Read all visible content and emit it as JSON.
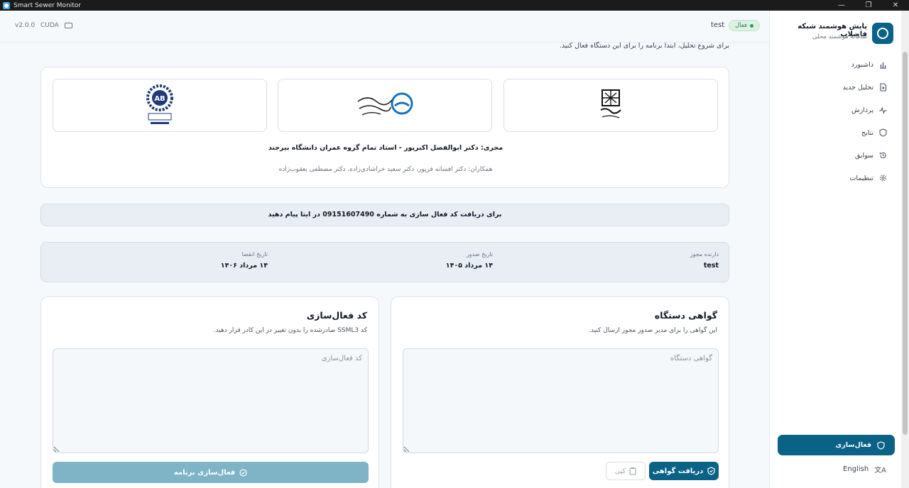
{
  "window": {
    "title": "Smart Sewer Monitor"
  },
  "topbar": {
    "version": "v2.0.0",
    "device": "CUDA",
    "user": "test",
    "status": "فعال"
  },
  "instruction": "برای شروع تحلیل، ابتدا برنامه را برای این دستگاه فعال کنید.",
  "credits": {
    "executor": "مجری: دکتر ابوالفضل اکبرپور - استاد تمام گروه عمران دانشگاه بیرجند",
    "colleagues": "همکاران: دکتر افسانه فرپور، دکتر سعید خراشادی‌زاده، دکتر مصطفی یعقوب‌زاده",
    "logos": [
      "logo-birjand-university",
      "logo-water-wastewater-company",
      "logo-abtiran"
    ]
  },
  "notice": "برای دریافت کد فعال سازی به شماره 09151607490 در ایتا پیام دهید",
  "license": {
    "holder_label": "دارنده مجوز",
    "holder": "test",
    "issue_label": "تاریخ صدور",
    "issue": "۱۴ مرداد ۱۴۰۵",
    "expire_label": "تاریخ انقضا",
    "expire": "۱۴ مرداد ۱۴۰۶"
  },
  "certificate": {
    "title": "گواهی دستگاه",
    "desc": "این گواهی را برای مدیر صدور مجوز ارسال کنید.",
    "placeholder": "گواهی دستگاه",
    "get_label": "دریافت گواهی",
    "copy_label": "کپی"
  },
  "activation": {
    "title": "کد فعال‌سازی",
    "desc": "کد SSML3 صادرشده را بدون تغییر در این کادر قرار دهید.",
    "placeholder": "کد فعال‌سازی",
    "activate_label": "فعال‌سازی برنامه"
  },
  "sidebar": {
    "title": "پایش هوشمند شبکه فاضلاب",
    "subtitle": "سامانه هوشمند محلی",
    "items": [
      {
        "label": "داشبورد",
        "icon": "bar-chart-icon"
      },
      {
        "label": "تحلیل جدید",
        "icon": "file-plus-icon"
      },
      {
        "label": "پردازش",
        "icon": "activity-icon"
      },
      {
        "label": "نتایج",
        "icon": "shield-icon"
      },
      {
        "label": "سوابق",
        "icon": "history-icon"
      },
      {
        "label": "تنظیمات",
        "icon": "gear-icon"
      }
    ],
    "activate": "فعال‌سازی",
    "language": "English"
  },
  "colors": {
    "primary": "#0b6287",
    "primary_disabled": "#7fb3c6",
    "status_green": "#22a45a"
  }
}
